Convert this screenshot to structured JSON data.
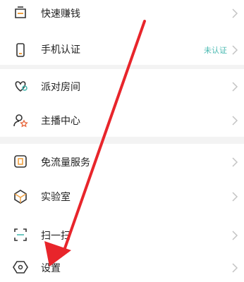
{
  "menu": {
    "items": [
      {
        "label": "快速赚钱"
      },
      {
        "label": "手机认证",
        "status": "未认证"
      },
      {
        "label": "派对房间"
      },
      {
        "label": "主播中心"
      },
      {
        "label": "免流量服务"
      },
      {
        "label": "实验室"
      },
      {
        "label": "扫一扫"
      },
      {
        "label": "设置"
      }
    ]
  },
  "colors": {
    "accent": "#49b9b1",
    "icon_orange": "#f0a040",
    "arrow": "#e8252b"
  },
  "icons": [
    "wallet-icon",
    "phone-icon",
    "heart-chat-icon",
    "user-star-icon",
    "sim-card-icon",
    "cube-icon",
    "scan-icon",
    "hexagon-gear-icon"
  ]
}
